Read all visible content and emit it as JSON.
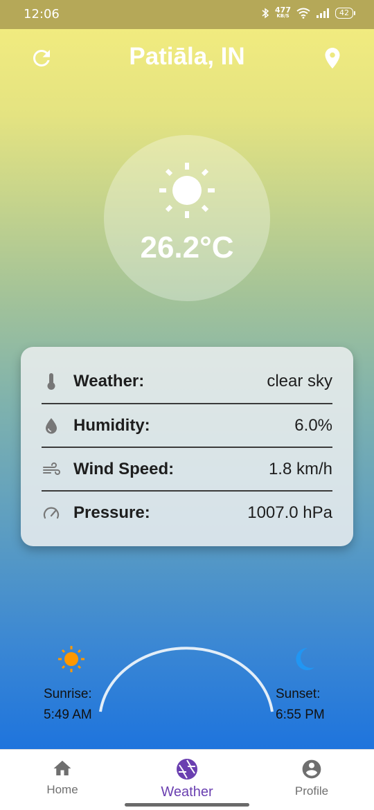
{
  "status_bar": {
    "time": "12:06",
    "net_speed_value": "477",
    "net_speed_unit": "KB/S",
    "battery": "42"
  },
  "header": {
    "city": "Patiāla, IN",
    "refresh_icon": "refresh-icon",
    "location_icon": "location-pin-icon"
  },
  "current": {
    "condition_icon": "sun-icon",
    "temperature": "26.2°C"
  },
  "details": [
    {
      "icon": "thermometer-icon",
      "label": "Weather:",
      "value": "clear sky"
    },
    {
      "icon": "water-drop-icon",
      "label": "Humidity:",
      "value": "6.0%"
    },
    {
      "icon": "wind-icon",
      "label": "Wind Speed:",
      "value": "1.8 km/h"
    },
    {
      "icon": "speedometer-icon",
      "label": "Pressure:",
      "value": "1007.0 hPa"
    }
  ],
  "sun_times": {
    "sunrise_label": "Sunrise:",
    "sunrise_time": "5:49 AM",
    "sunset_label": "Sunset:",
    "sunset_time": "6:55 PM"
  },
  "bottom_nav": {
    "items": [
      {
        "label": "Home",
        "icon": "home-icon"
      },
      {
        "label": "Weather",
        "icon": "camera-aperture-icon",
        "selected": true
      },
      {
        "label": "Profile",
        "icon": "account-circle-icon"
      }
    ]
  },
  "colors": {
    "accent": "#6a3fb0",
    "sunrise_sun": "#ff9800",
    "sunset_moon": "#2196f3",
    "status_bar": "#b5a858"
  }
}
